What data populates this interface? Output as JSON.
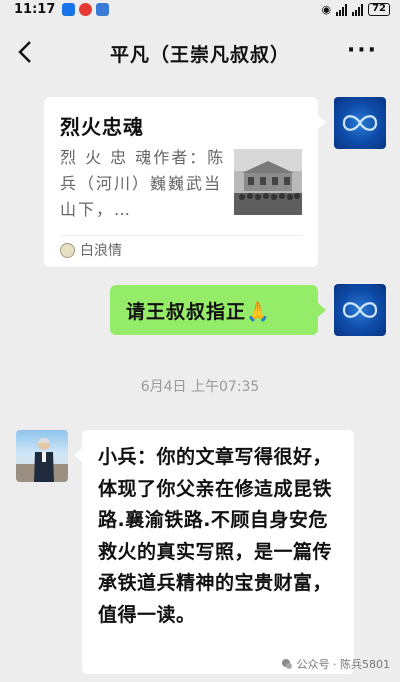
{
  "status_bar": {
    "time": "11:17",
    "battery": "72"
  },
  "header": {
    "title": "平凡（王崇凡叔叔）",
    "back_icon": "chevron-left-icon",
    "more_icon": "more-dots-icon",
    "back_glyph": "❮",
    "more_glyph": "···"
  },
  "messages": {
    "card": {
      "title": "烈火忠魂",
      "description": "烈 火 忠 魂作者：陈兵（河川）巍巍武当山下，…",
      "source": "白浪情"
    },
    "sent_text": "请王叔叔指正🙏",
    "timestamp": "6月4日 上午07:35",
    "received_text": "小兵：你的文章写得很好，体现了你父亲在修迼成昆铁路.襄渝铁路.不顾自身安危救火的真实写照，是一篇传承铁道兵精神的宝贵财富，值得一读。"
  },
  "watermark": "公众号 · 陈兵5801",
  "colors": {
    "background": "#ededed",
    "sent_bubble": "#95ec69",
    "received_bubble": "#ffffff",
    "avatar_blue": "#0d4aa6"
  }
}
